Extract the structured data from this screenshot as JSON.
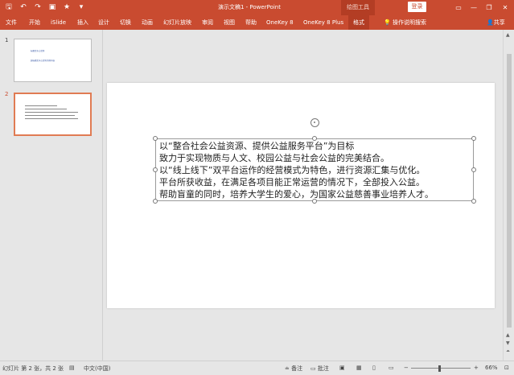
{
  "window": {
    "title": "演示文稿1 - PowerPoint",
    "contextual_tab_group": "绘图工具",
    "login_label": "登录",
    "controls": {
      "minimize": "—",
      "restore": "❐",
      "close": "✕"
    }
  },
  "quick_access": [
    "save-icon",
    "undo-icon",
    "redo-icon",
    "start-from-beginning-icon",
    "customize-qat-icon"
  ],
  "ribbon": {
    "tabs": [
      "文件",
      "开始",
      "iSlide",
      "插入",
      "设计",
      "切换",
      "动画",
      "幻灯片放映",
      "审阅",
      "视图",
      "帮助",
      "OneKey 8",
      "OneKey 8 Plus",
      "格式"
    ],
    "active_tab": "格式",
    "tell_me": "操作说明搜索",
    "share": "共享"
  },
  "thumbnails": {
    "items": [
      {
        "number": "1",
        "line1": "标题文字占位符",
        "line2": "副标题文字占位符示例内容"
      },
      {
        "number": "2",
        "selected": true
      }
    ]
  },
  "slide": {
    "paragraphs": [
      "以“整合社会公益资源、提供公益服务平台”为目标",
      "致力于实现物质与人文、校园公益与社会公益的完美结合。",
      "以“线上线下”双平台运作的经营模式为特色，进行资源汇集与优化。",
      "平台所获收益，在满足各项目能正常运营的情况下，全部投入公益。",
      "帮助盲童的同时，培养大学生的爱心，为国家公益慈善事业培养人才。"
    ]
  },
  "status": {
    "slide_info": "幻灯片 第 2 张，共 2 张",
    "language": "中文(中国)",
    "notes_label": "备注",
    "comments_label": "批注",
    "zoom_percent": "66%",
    "zoom_out": "−",
    "zoom_in": "+"
  },
  "colors": {
    "ribbon": "#c94b30",
    "selected_thumb_border": "#e07b53"
  }
}
